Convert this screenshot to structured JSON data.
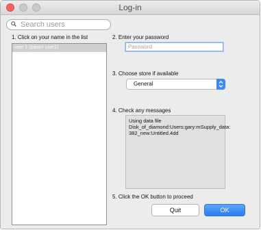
{
  "window": {
    "title": "Log-in"
  },
  "search": {
    "placeholder": "Search users"
  },
  "steps": {
    "step1": "1. Click on your name in the list",
    "step2": "2. Enter your password",
    "step3": "3. Choose store if available",
    "step4": "4. Check any messages",
    "step5": "5. Click the OK button to proceed"
  },
  "user_list": {
    "items": [
      {
        "label": "user 1 (pass= user1)"
      }
    ]
  },
  "password": {
    "placeholder": "Password",
    "value": ""
  },
  "store": {
    "selected": "General"
  },
  "messages": {
    "lines": [
      "Using data file",
      "Disk_of_diamond:Users:gary:mSupply_data:",
      "382_new:Untitled.4dd"
    ]
  },
  "buttons": {
    "quit": "Quit",
    "ok": "OK"
  },
  "colors": {
    "close": "#fc605c",
    "accent": "#3b88f7"
  },
  "icons": {
    "search": "search-icon",
    "select_arrows": "chevron-updown-icon"
  }
}
